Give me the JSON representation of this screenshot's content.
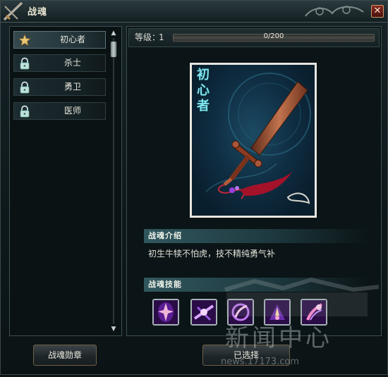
{
  "window": {
    "title": "战魂",
    "close_label": "✕"
  },
  "sidebar": {
    "items": [
      {
        "label": "初心者",
        "icon": "star-icon",
        "selected": true
      },
      {
        "label": "杀士",
        "icon": "lock-icon",
        "selected": false
      },
      {
        "label": "勇卫",
        "icon": "lock-icon",
        "selected": false
      },
      {
        "label": "医师",
        "icon": "lock-icon",
        "selected": false
      }
    ]
  },
  "level": {
    "label": "等级：",
    "value": "1",
    "progress_text": "0/200",
    "progress_fraction": 0
  },
  "card": {
    "name": "初心者"
  },
  "intro": {
    "header": "战魂介绍",
    "text": "初生牛犊不怕虎，技不精纯勇气补"
  },
  "skills": {
    "header": "战魂技能",
    "items": [
      "skill-icon-1",
      "skill-icon-2",
      "skill-icon-3",
      "skill-icon-4",
      "skill-icon-5"
    ]
  },
  "buttons": {
    "medal": "战魂勋章",
    "selected": "已选择"
  },
  "watermark": {
    "brand": "新闻中心",
    "url": "news.17173.com"
  },
  "colors": {
    "accent": "#d9b04a",
    "card_text": "#7fe7f1",
    "skill_bg": "#2b0a45"
  }
}
